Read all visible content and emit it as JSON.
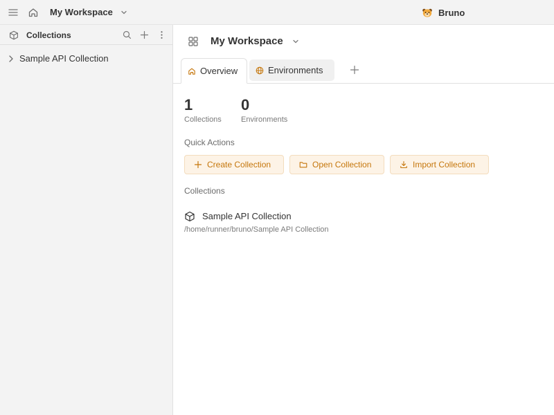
{
  "topbar": {
    "menu_icon": "menu-icon",
    "home_icon": "home-icon",
    "workspace_name": "My Workspace",
    "brand_name": "Bruno"
  },
  "sidebar": {
    "title": "Collections",
    "items": [
      {
        "label": "Sample API Collection",
        "icon": "chevron-right-icon"
      }
    ]
  },
  "main": {
    "workspace_title": "My Workspace",
    "tabs": [
      {
        "label": "Overview",
        "icon": "home-icon",
        "active": true
      },
      {
        "label": "Environments",
        "icon": "globe-icon",
        "active": false
      }
    ],
    "stats": [
      {
        "value": "1",
        "label": "Collections"
      },
      {
        "value": "0",
        "label": "Environments"
      }
    ],
    "quick_actions_label": "Quick Actions",
    "quick_actions": [
      {
        "label": "Create Collection",
        "icon": "plus-icon"
      },
      {
        "label": "Open Collection",
        "icon": "folder-icon"
      },
      {
        "label": "Import Collection",
        "icon": "download-icon"
      }
    ],
    "collections_label": "Collections",
    "collections": [
      {
        "name": "Sample API Collection",
        "path": "/home/runner/bruno/Sample API Collection"
      }
    ]
  },
  "colors": {
    "accent": "#c5760b",
    "accent_bg": "#fdf3e6",
    "sidebar_bg": "#f3f3f3"
  }
}
